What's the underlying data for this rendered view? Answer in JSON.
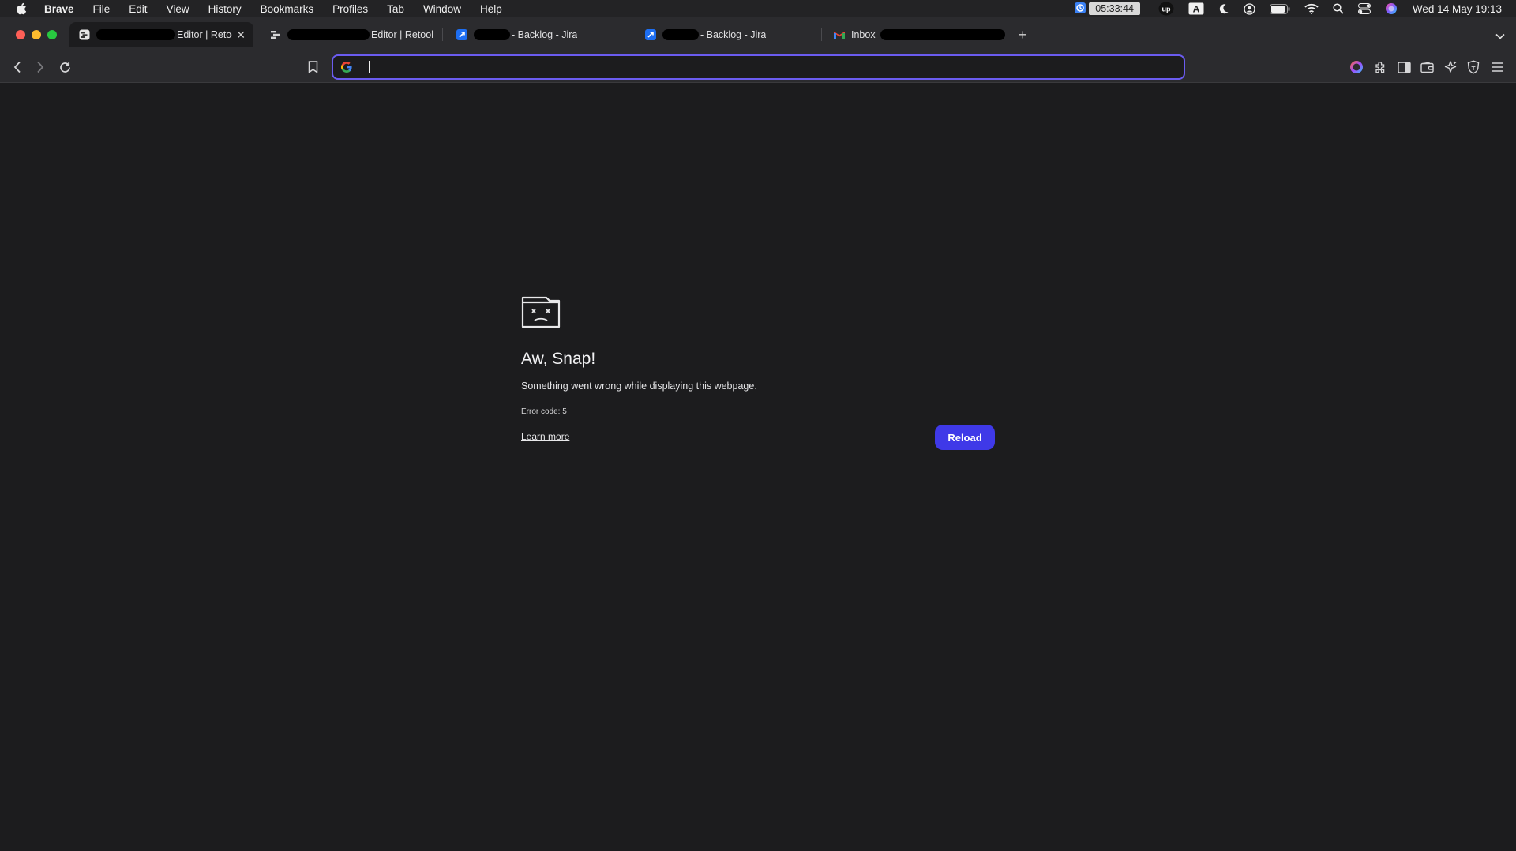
{
  "menubar": {
    "app_name": "Brave",
    "items": [
      "File",
      "Edit",
      "View",
      "History",
      "Bookmarks",
      "Profiles",
      "Tab",
      "Window",
      "Help"
    ],
    "timer": "05:33:44",
    "input_source": "A",
    "clock": "Wed 14 May  19:13"
  },
  "tabs": [
    {
      "title": "Editor | Retool",
      "active": true,
      "icon": "retool-icon"
    },
    {
      "title": "Editor | Retool",
      "active": false,
      "icon": "retool-icon"
    },
    {
      "title": "- Backlog - Jira",
      "active": false,
      "icon": "jira-icon"
    },
    {
      "title": "- Backlog - Jira",
      "active": false,
      "icon": "jira-icon"
    },
    {
      "title": "Inbox",
      "active": false,
      "icon": "gmail-icon"
    }
  ],
  "toolbar": {
    "url_value": "",
    "accent": "#6b5cf0"
  },
  "error_page": {
    "heading": "Aw, Snap!",
    "message": "Something went wrong while displaying this webpage.",
    "error_code": "Error code: 5",
    "learn_more": "Learn more",
    "reload_label": "Reload",
    "button_color": "#3f39e8"
  }
}
